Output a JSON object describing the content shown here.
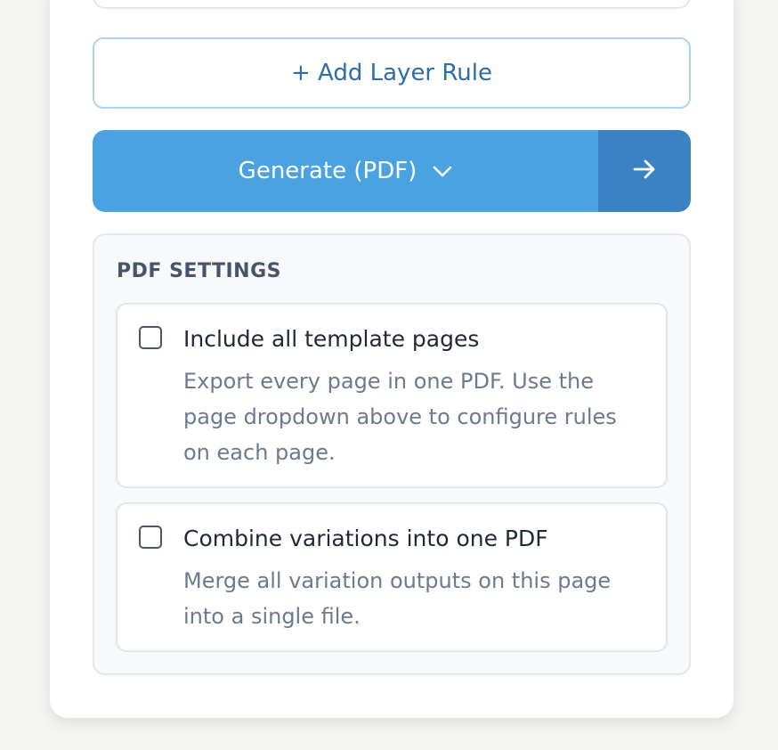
{
  "actions": {
    "add_layer_rule_label": "+ Add Layer Rule",
    "generate_label": "Generate (PDF)"
  },
  "pdf_settings": {
    "title": "PDF SETTINGS",
    "options": [
      {
        "title": "Include all template pages",
        "description": "Export every page in one PDF. Use the page dropdown above to configure rules on each page.",
        "checked": false
      },
      {
        "title": "Combine variations into one PDF",
        "description": "Merge all variation outputs on this page into a single file.",
        "checked": false
      }
    ]
  },
  "colors": {
    "primary": "#4aa3e0",
    "primary_dark": "#3b82c4",
    "outline": "#a9d4f2",
    "link_text": "#2f6da3"
  },
  "icons": {
    "dropdown": "chevron-down-icon",
    "go": "arrow-right-icon"
  }
}
